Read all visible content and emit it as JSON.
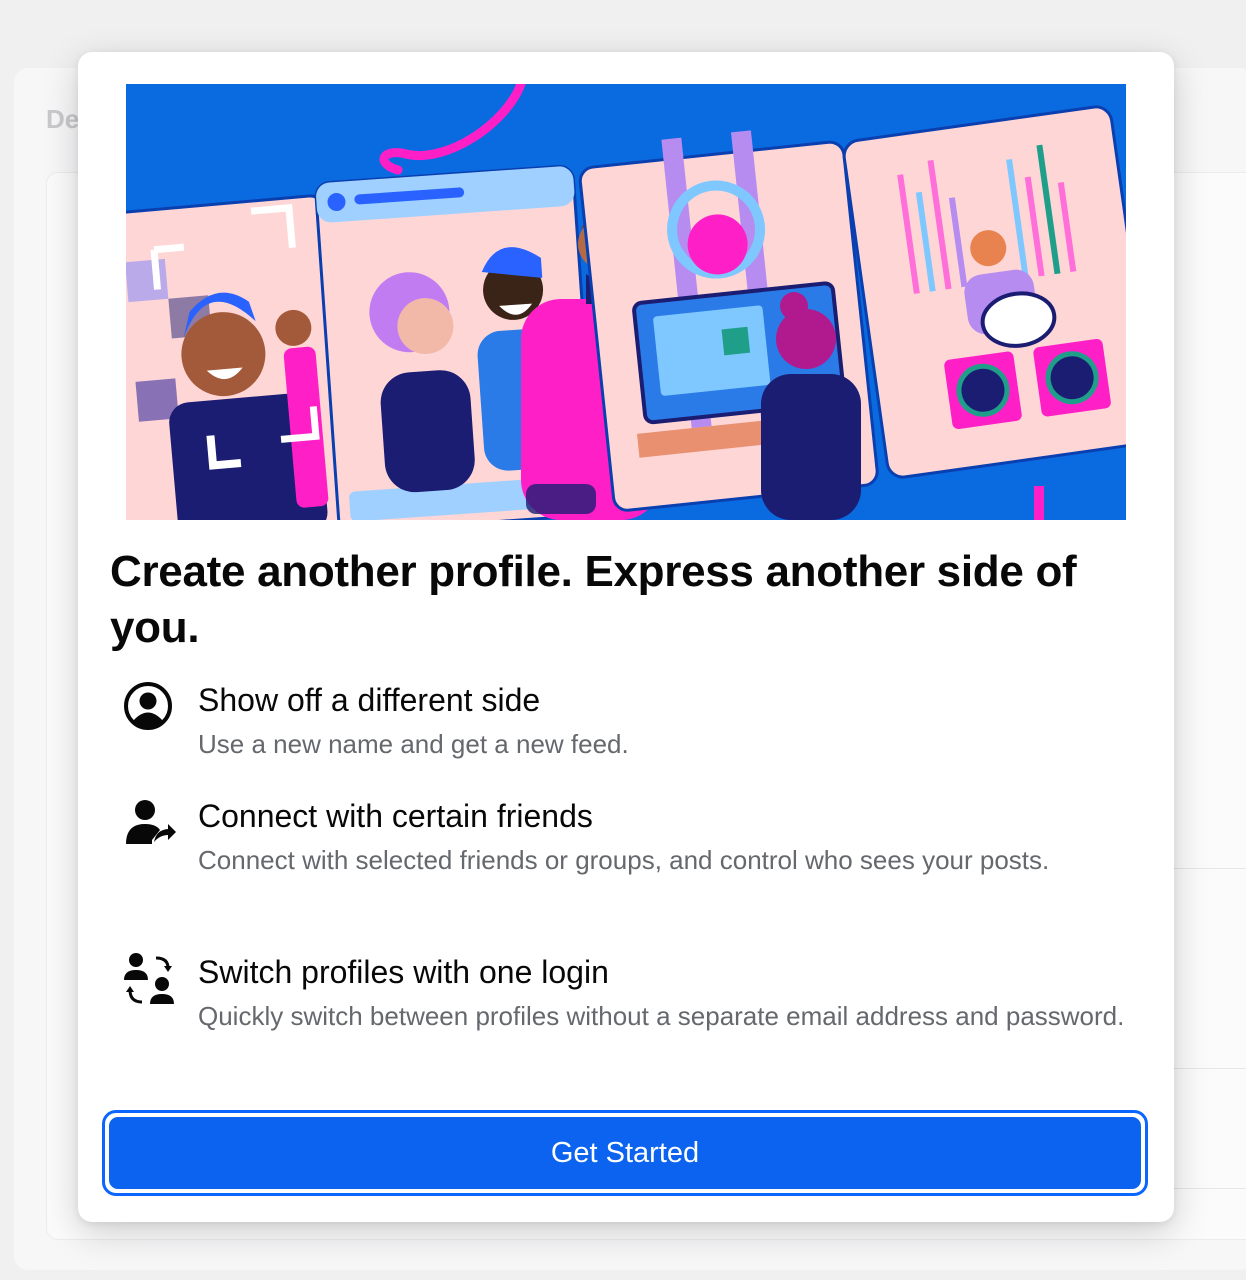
{
  "background": {
    "heading_fragment": "De"
  },
  "modal": {
    "hero_image": "illustration-of-people-on-profile-cards",
    "title": "Create another profile. Express another side of you.",
    "features": [
      {
        "icon": "profile-circle-icon",
        "title": "Show off a different side",
        "description": "Use a new name and get a new feed."
      },
      {
        "icon": "person-share-icon",
        "title": "Connect with certain friends",
        "description": "Connect with selected friends or groups, and control who sees your posts."
      },
      {
        "icon": "switch-profiles-icon",
        "title": "Switch profiles with one login",
        "description": "Quickly switch between profiles without a separate email address and password."
      }
    ],
    "cta_label": "Get Started"
  },
  "colors": {
    "primary": "#0b63f0",
    "text": "#080809",
    "secondary_text": "#65686c",
    "hero_blue": "#0a6be0",
    "hero_pink": "#ff1fc7",
    "hero_card": "#ffd6d6",
    "hero_navy": "#1b1d73"
  }
}
